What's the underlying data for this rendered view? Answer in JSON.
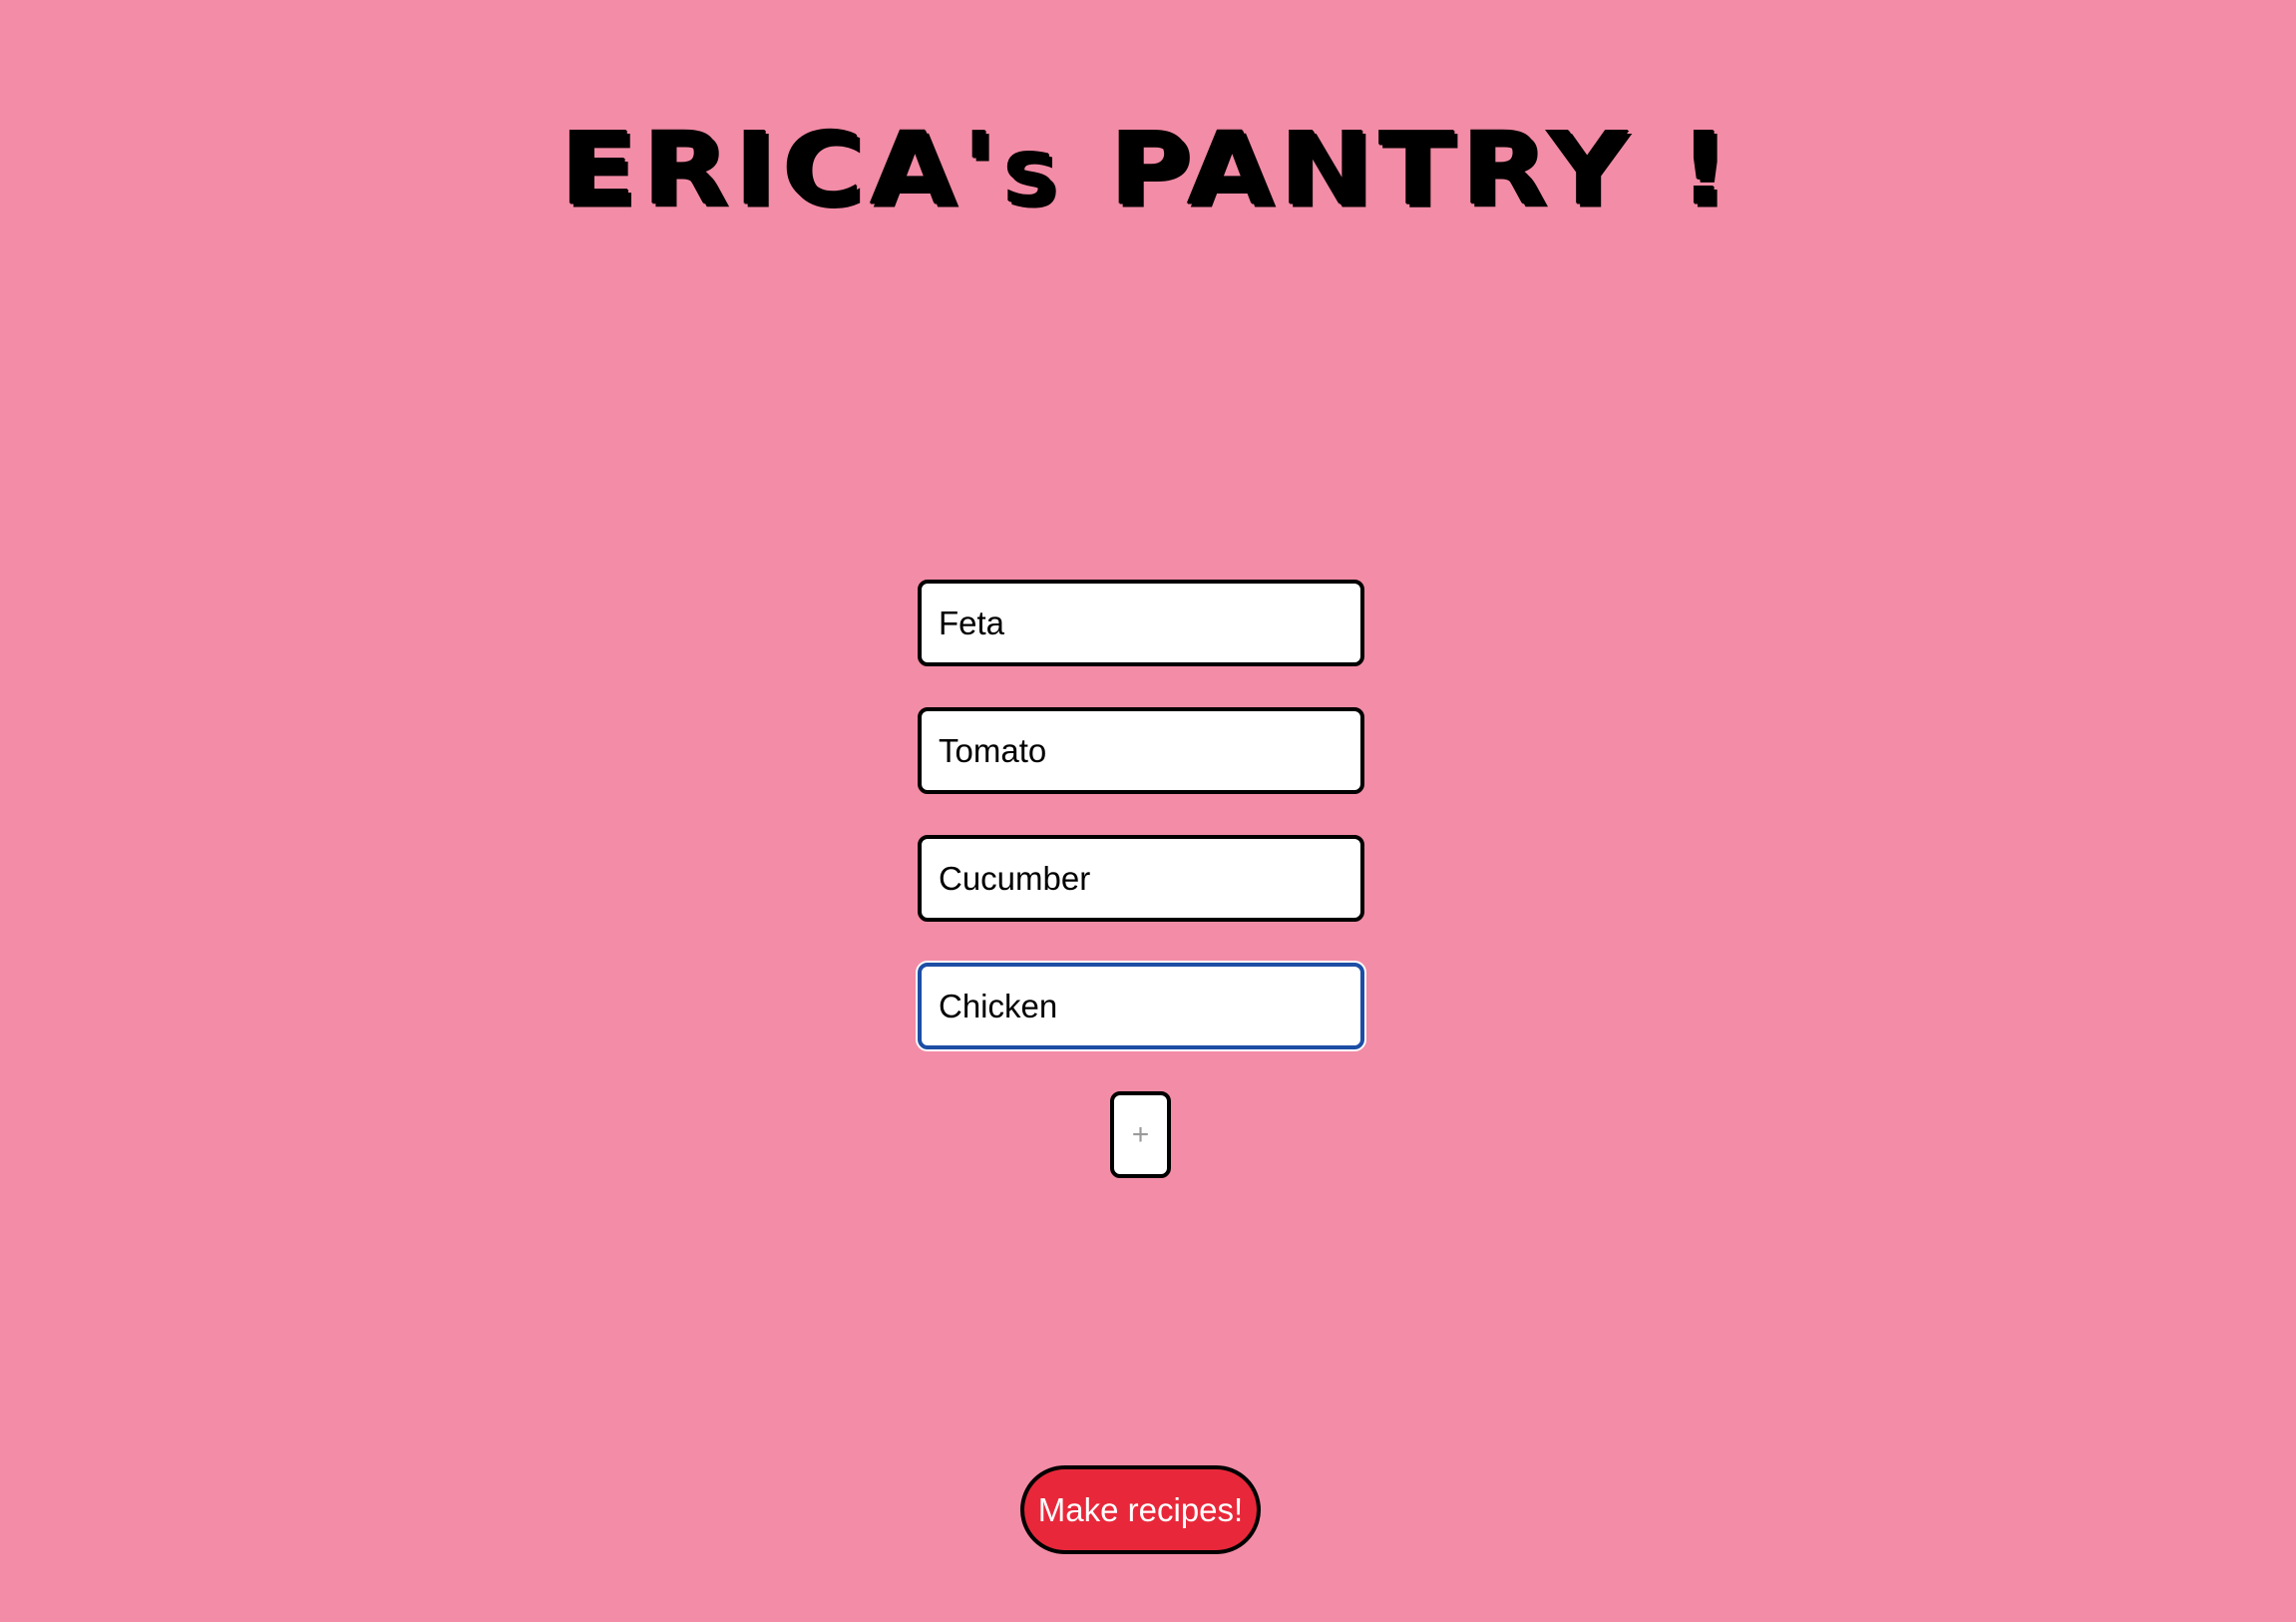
{
  "header": {
    "title": "ERICA's PANTRY !"
  },
  "ingredients": [
    {
      "value": "Feta"
    },
    {
      "value": "Tomato"
    },
    {
      "value": "Cucumber"
    },
    {
      "value": "Chicken"
    }
  ],
  "add_button": {
    "label": "+"
  },
  "submit_button": {
    "label": "Make recipes!"
  },
  "colors": {
    "background": "#f38ca6",
    "submit": "#e8283a",
    "focus_border": "#1d4ea5"
  }
}
